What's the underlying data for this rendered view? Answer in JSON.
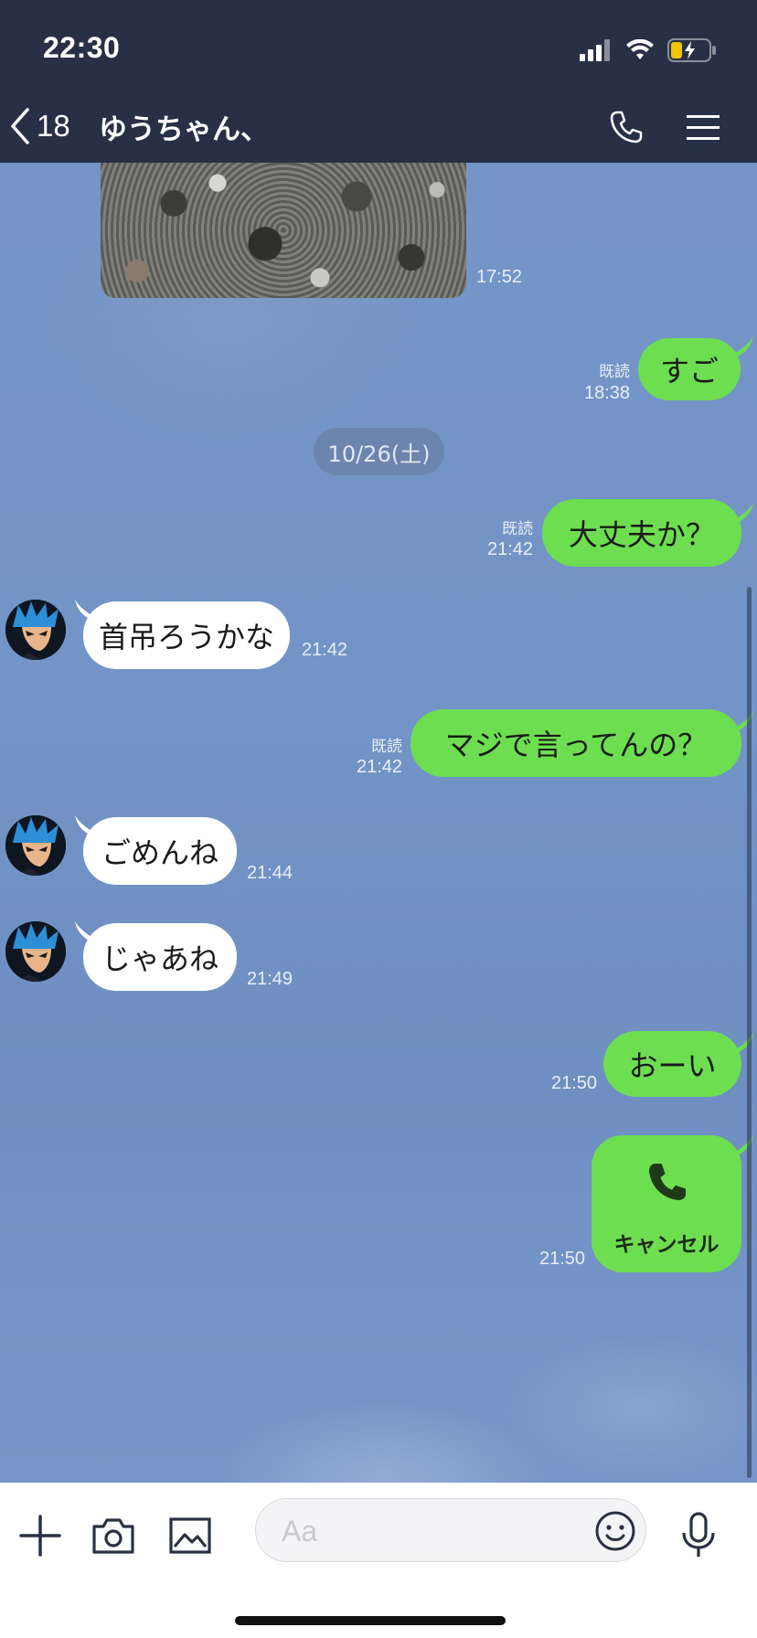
{
  "status": {
    "time": "22:30"
  },
  "header": {
    "back_count": "18",
    "title": "ゆうちゃん、"
  },
  "messages": {
    "photo_time": "17:52",
    "m1": {
      "text": "すご",
      "read": "既読",
      "time": "18:38"
    },
    "date_separator": "10/26(土)",
    "m2": {
      "text": "大丈夫か？",
      "read": "既読",
      "time": "21:42"
    },
    "m3": {
      "text": "首吊ろうかな",
      "time": "21:42"
    },
    "m4": {
      "text": "マジで言ってんの？",
      "read": "既読",
      "time": "21:42"
    },
    "m5": {
      "text": "ごめんね",
      "time": "21:44"
    },
    "m6": {
      "text": "じゃあね",
      "time": "21:49"
    },
    "m7": {
      "text": "おーい",
      "time": "21:50"
    },
    "m8": {
      "call_label": "キャンセル",
      "time": "21:50"
    }
  },
  "input": {
    "placeholder": "Aa"
  },
  "colors": {
    "header_bg": "#283046",
    "bubble_green": "#6dde4f",
    "chat_bg": "#7394c6"
  }
}
